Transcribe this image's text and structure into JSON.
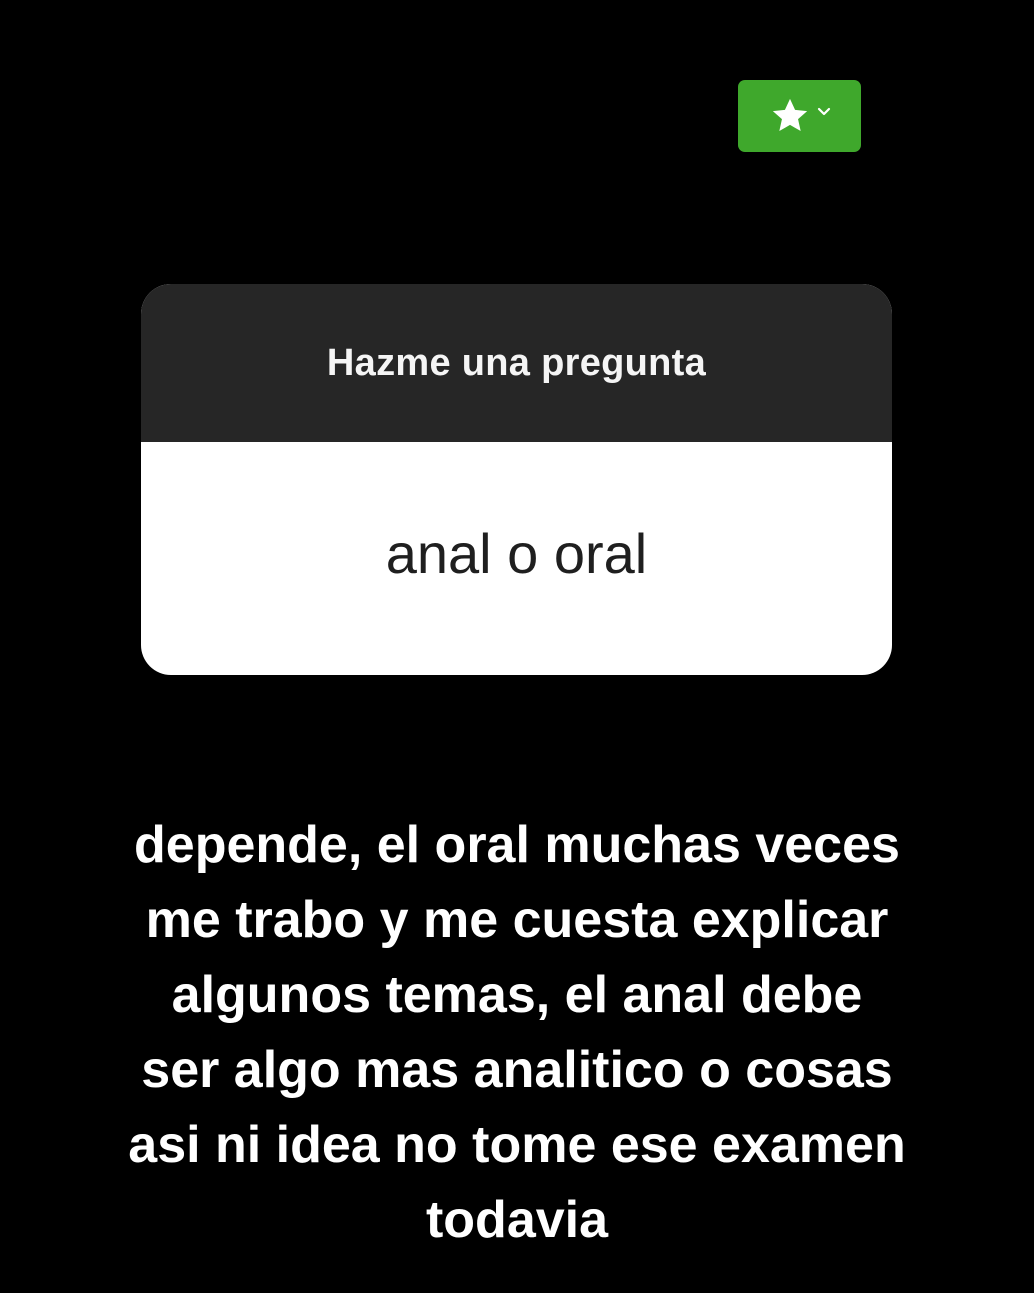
{
  "badge": {
    "icon": "star-icon",
    "dropdown_icon": "chevron-down-icon",
    "color": "#3fa82c"
  },
  "question_card": {
    "header": "Hazme una pregunta",
    "question": "anal o oral"
  },
  "answer": {
    "lines": [
      "depende, el oral muchas veces",
      "me trabo y me cuesta explicar",
      "algunos temas, el anal debe",
      "ser algo mas analitico o cosas",
      "asi ni idea no tome ese examen",
      "todavia"
    ]
  }
}
